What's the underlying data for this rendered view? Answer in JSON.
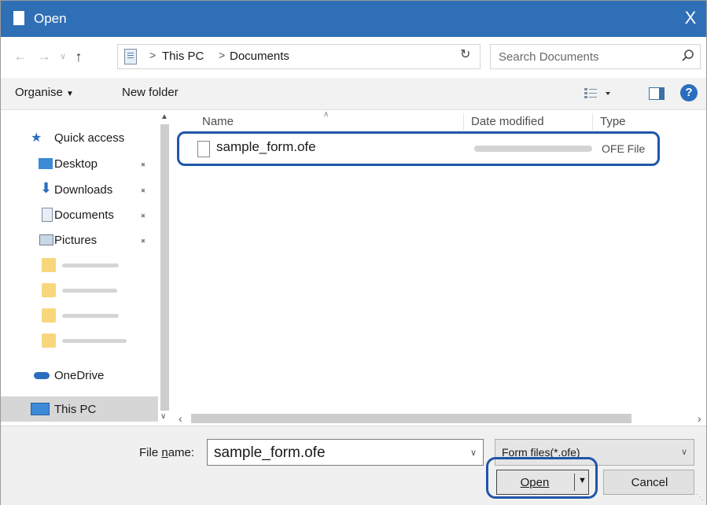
{
  "window": {
    "title": "Open",
    "close_glyph": "X"
  },
  "address": {
    "separator": ">",
    "crumbs": [
      "This PC",
      "Documents"
    ],
    "search_placeholder": "Search Documents"
  },
  "toolbar": {
    "organise_label": "Organise",
    "new_folder_label": "New folder"
  },
  "nav": {
    "quick_access": "Quick access",
    "pinned": [
      "Desktop",
      "Downloads",
      "Documents",
      "Pictures"
    ],
    "onedrive": "OneDrive",
    "this_pc": "This PC"
  },
  "columns": {
    "name": "Name",
    "date_modified": "Date modified",
    "type": "Type"
  },
  "files": [
    {
      "name": "sample_form.ofe",
      "type": "OFE File"
    }
  ],
  "footer": {
    "file_name_label_pre": "File ",
    "file_name_label_key": "n",
    "file_name_label_post": "ame:",
    "file_name_value": "sample_form.ofe",
    "file_type_value": "Form files(*.ofe)",
    "open_label": "Open",
    "cancel_label": "Cancel"
  },
  "colors": {
    "titlebar": "#2f6fb6",
    "highlight": "#1f56a8",
    "help_icon": "#2a6ebd",
    "folder": "#f7d67c"
  },
  "icons": [
    "document-icon",
    "close-icon",
    "back-arrow-icon",
    "forward-arrow-icon",
    "up-arrow-icon",
    "refresh-icon",
    "search-icon",
    "view-options-icon",
    "preview-pane-icon",
    "help-icon",
    "star-icon",
    "desktop-icon",
    "download-icon",
    "documents-icon",
    "pictures-icon",
    "folder-icon",
    "cloud-icon",
    "computer-icon",
    "pin-icon",
    "file-icon"
  ]
}
